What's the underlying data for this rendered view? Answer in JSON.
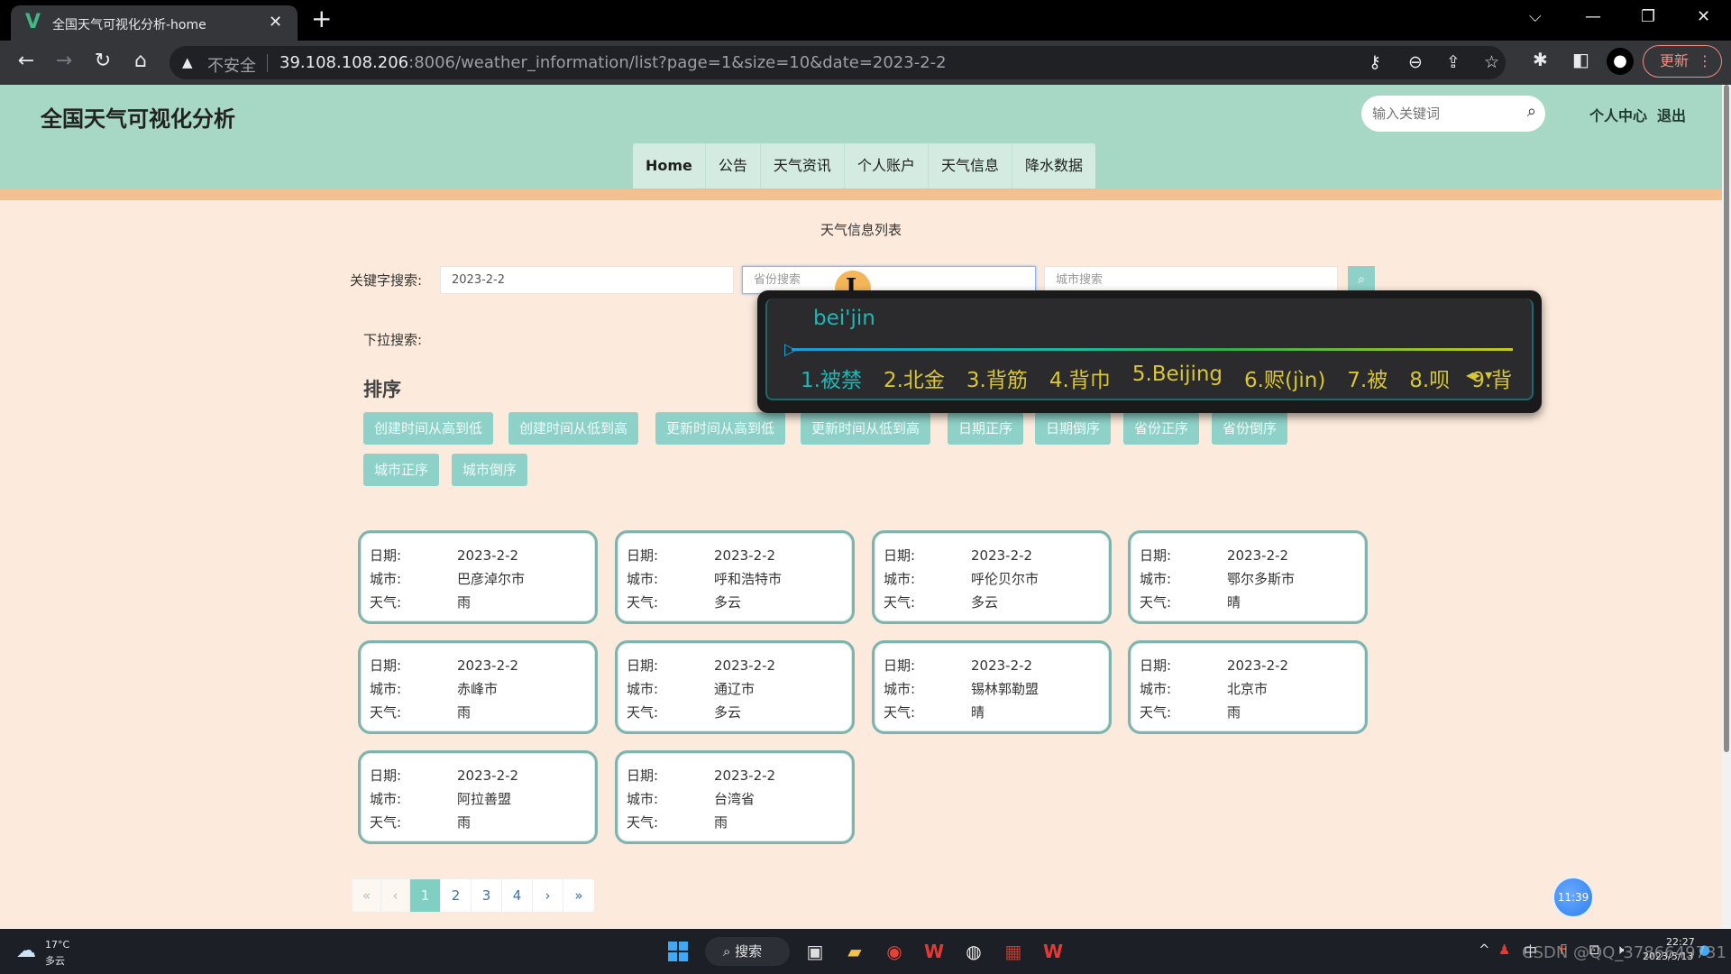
{
  "browser": {
    "tab_title": "全国天气可视化分析-home",
    "tab_logo": "V",
    "new_tab": "+",
    "security_label": "不安全",
    "url_host": "39.108.108.206",
    "url_rest": ":8006/weather_information/list?page=1&size=10&date=2023-2-2",
    "update_label": "更新",
    "icons": [
      "back-icon",
      "forward-icon",
      "reload-icon",
      "home-icon",
      "warning-icon",
      "key-icon",
      "zoom-out-icon",
      "share-icon",
      "star-icon",
      "extensions-icon",
      "sidepanel-icon",
      "profile-icon",
      "menu-icon"
    ]
  },
  "site": {
    "title": "全国天气可视化分析",
    "search_placeholder": "输入关键词",
    "user_center": "个人中心",
    "logout": "退出",
    "menu": [
      "Home",
      "公告",
      "天气资讯",
      "个人账户",
      "天气信息",
      "降水数据"
    ]
  },
  "main": {
    "page_title": "天气信息列表",
    "keyword_label": "关键字搜索:",
    "date_value": "2023-2-2",
    "province_placeholder": "省份搜索",
    "city_placeholder": "城市搜索",
    "dropdown_label": "下拉搜索:",
    "sort_title": "排序",
    "sort_buttons": [
      "创建时间从高到低",
      "创建时间从低到高",
      "更新时间从高到低",
      "更新时间从低到高",
      "日期正序",
      "日期倒序",
      "省份正序",
      "省份倒序",
      "城市正序",
      "城市倒序"
    ],
    "card_labels": {
      "date": "日期:",
      "city": "城市:",
      "weather": "天气:"
    },
    "cards": [
      {
        "date": "2023-2-2",
        "city": "巴彦淖尔市",
        "weather": "雨"
      },
      {
        "date": "2023-2-2",
        "city": "呼和浩特市",
        "weather": "多云"
      },
      {
        "date": "2023-2-2",
        "city": "呼伦贝尔市",
        "weather": "多云"
      },
      {
        "date": "2023-2-2",
        "city": "鄂尔多斯市",
        "weather": "晴"
      },
      {
        "date": "2023-2-2",
        "city": "赤峰市",
        "weather": "雨"
      },
      {
        "date": "2023-2-2",
        "city": "通辽市",
        "weather": "多云"
      },
      {
        "date": "2023-2-2",
        "city": "锡林郭勒盟",
        "weather": "晴"
      },
      {
        "date": "2023-2-2",
        "city": "北京市",
        "weather": "雨"
      },
      {
        "date": "2023-2-2",
        "city": "阿拉善盟",
        "weather": "雨"
      },
      {
        "date": "2023-2-2",
        "city": "台湾省",
        "weather": "雨"
      }
    ],
    "pagination": {
      "first": "«",
      "prev": "‹",
      "pages": [
        "1",
        "2",
        "3",
        "4"
      ],
      "current": "1",
      "next": "›",
      "last": "»"
    },
    "clock_bubble": "11:39"
  },
  "ime": {
    "composition": "bei'jin",
    "candidates": [
      "1.被禁",
      "2.北金",
      "3.背筋",
      "4.背巾",
      "5.Beijing",
      "6.赆(jìn)",
      "7.被",
      "8.呗",
      "9.背"
    ]
  },
  "taskbar": {
    "weather_temp": "17°C",
    "weather_desc": "多云",
    "search_label": "搜索",
    "time": "22:27",
    "date": "2023/5/13",
    "watermark": "CSDN @QQ_3786649731",
    "ime_indicator": "中"
  }
}
